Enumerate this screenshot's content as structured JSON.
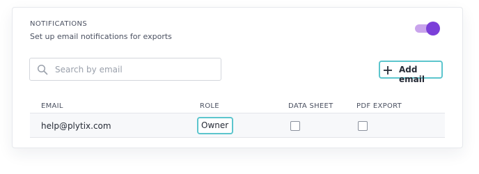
{
  "notifications": {
    "title": "NOTIFICATIONS",
    "subtitle": "Set up email notifications for exports",
    "toggle_on": true
  },
  "search": {
    "placeholder": "Search by email",
    "icon": "search-icon"
  },
  "add_email_button": {
    "label": "Add email",
    "icon": "plus-icon"
  },
  "table": {
    "headers": [
      "EMAIL",
      "ROLE",
      "DATA SHEET",
      "PDF EXPORT"
    ],
    "rows": [
      {
        "email": "help@plytix.com",
        "role": "Owner",
        "data_sheet_checked": false,
        "pdf_export_checked": false
      }
    ]
  },
  "colors": {
    "accent": "#7b3fd9",
    "accent_light": "#c9a4ec",
    "focus_outline": "#5cc5cd"
  }
}
